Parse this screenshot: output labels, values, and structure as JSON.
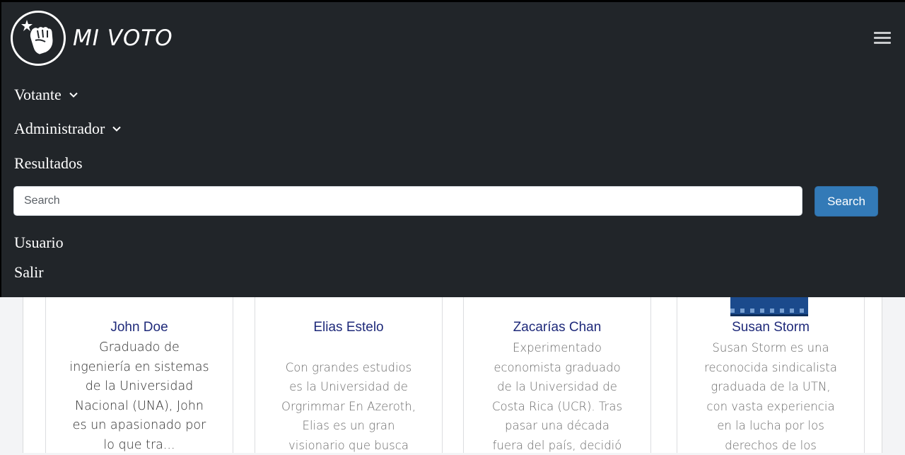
{
  "brand": {
    "name": "MI VOTO"
  },
  "nav": {
    "items": [
      {
        "label": "Votante",
        "dropdown": true
      },
      {
        "label": "Administrador",
        "dropdown": true
      },
      {
        "label": "Resultados",
        "dropdown": false
      }
    ],
    "search": {
      "placeholder": "Search",
      "value": "",
      "button_label": "Search"
    },
    "user_items": [
      {
        "label": "Usuario"
      },
      {
        "label": "Salir"
      }
    ]
  },
  "candidates": [
    {
      "name": "John Doe",
      "description_lines": [
        "Graduado de",
        "ingeniería en sistemas",
        "de la Universidad",
        "Nacional (UNA), John",
        "es un apasionado por",
        "lo que tra..."
      ]
    },
    {
      "name": "Elias Estelo",
      "description_lines": [
        "",
        "Con grandes estudios",
        "es la Universidad de",
        "Orgrimmar En Azeroth,",
        "Elias es un gran",
        "visionario que busca"
      ]
    },
    {
      "name": "Zacarías Chan",
      "description_lines": [
        "Experimentado",
        "economista graduado",
        "de la Universidad de",
        "Costa Rica (UCR). Tras",
        "pasar una década",
        "fuera del país, decidió"
      ]
    },
    {
      "name": "Susan Storm",
      "description_lines": [
        "Susan Storm es una",
        "reconocida sindicalista",
        "graduada de la UTN,",
        "con vasta experiencia",
        "en la lucha por los",
        "derechos de los"
      ]
    }
  ],
  "colors": {
    "navbar_bg": "#212529",
    "search_button": "#337ab7",
    "candidate_name": "#1f2a7a"
  }
}
